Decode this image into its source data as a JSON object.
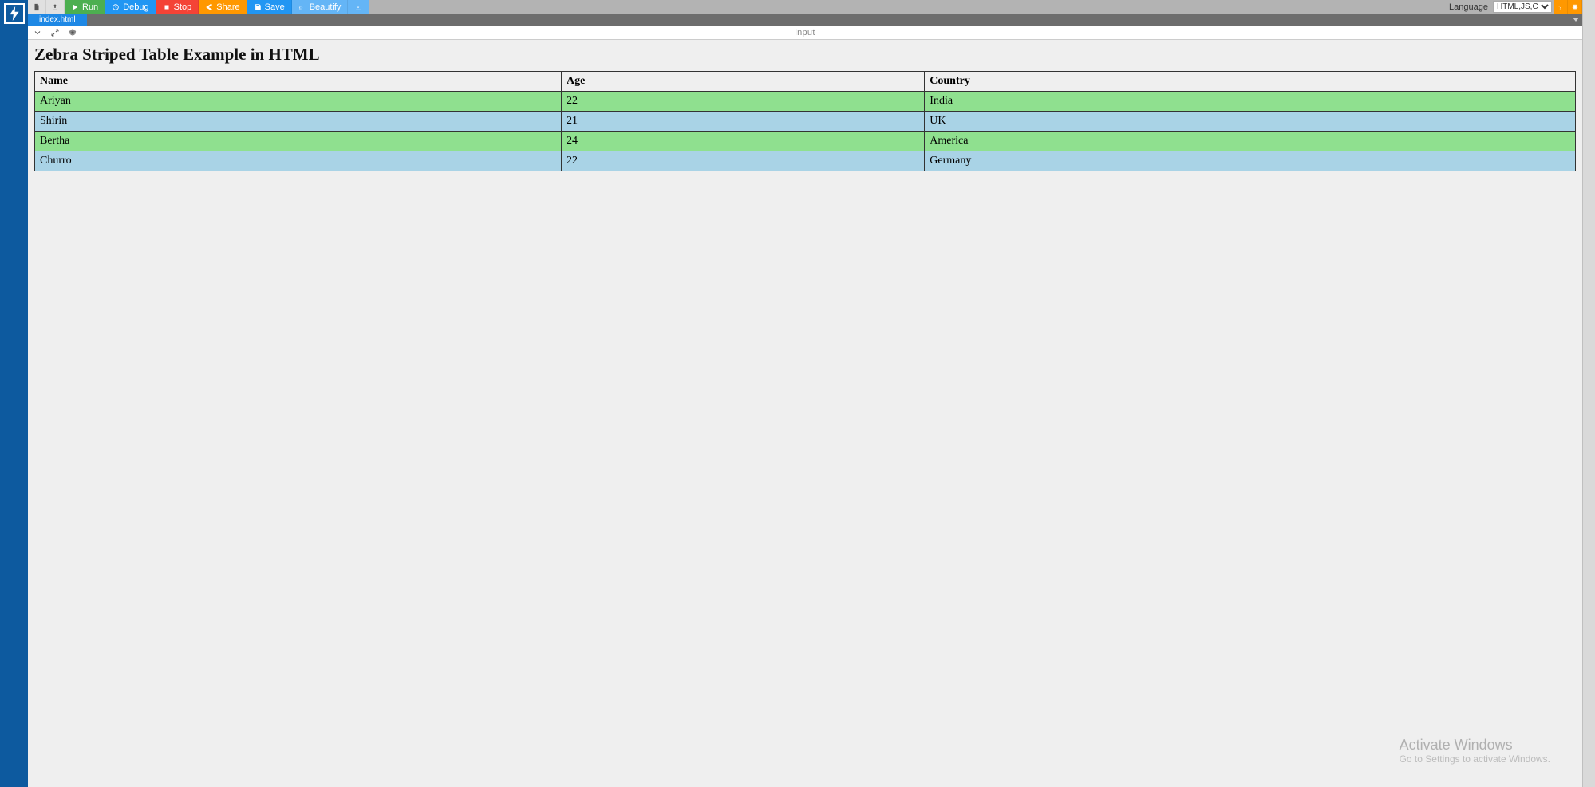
{
  "toolbar": {
    "run": "Run",
    "debug": "Debug",
    "stop": "Stop",
    "share": "Share",
    "save": "Save",
    "beautify": "Beautify",
    "language_label": "Language",
    "language_value": "HTML,JS,C"
  },
  "tabs": {
    "active": "index.html"
  },
  "panel": {
    "title": "input"
  },
  "page": {
    "heading": "Zebra Striped Table Example in HTML",
    "columns": [
      "Name",
      "Age",
      "Country"
    ],
    "rows": [
      {
        "name": "Ariyan",
        "age": "22",
        "country": "India"
      },
      {
        "name": "Shirin",
        "age": "21",
        "country": "UK"
      },
      {
        "name": "Bertha",
        "age": "24",
        "country": "America"
      },
      {
        "name": "Churro",
        "age": "22",
        "country": "Germany"
      }
    ]
  },
  "watermark": {
    "line1": "Activate Windows",
    "line2": "Go to Settings to activate Windows."
  }
}
